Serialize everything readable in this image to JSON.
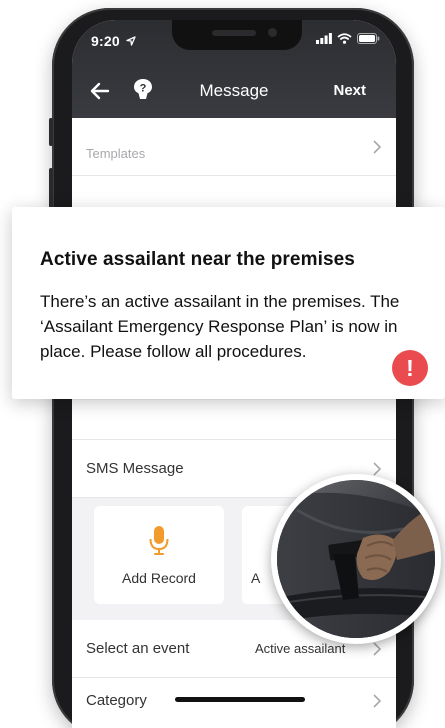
{
  "status_bar": {
    "time": "9:20"
  },
  "nav": {
    "title": "Message",
    "next_label": "Next"
  },
  "rows": {
    "templates": "Templates",
    "sms_message": "SMS Message",
    "select_event_label": "Select an event",
    "select_event_value": "Active assailant",
    "category": "Category"
  },
  "cards": {
    "add_record": "Add Record",
    "second_partial": "A"
  },
  "toast": {
    "title": "Active assailant near the premises",
    "body": "There’s an active assailant in the premises. The ‘Assailant Emergency Response Plan’ is now in place. Please follow all procedures.",
    "alert_symbol": "!"
  },
  "colors": {
    "accent_orange": "#f39a2c",
    "alert_red": "#e94b4e",
    "nav_bg": "#2c2d31"
  },
  "icons": {
    "back": "arrow-left-icon",
    "help": "help-icon",
    "mic": "microphone-icon",
    "chevron": "chevron-right-icon",
    "alert": "exclamation-icon",
    "signal": "cellular-signal-icon",
    "wifi": "wifi-icon",
    "battery": "battery-icon",
    "location": "location-arrow-icon"
  }
}
